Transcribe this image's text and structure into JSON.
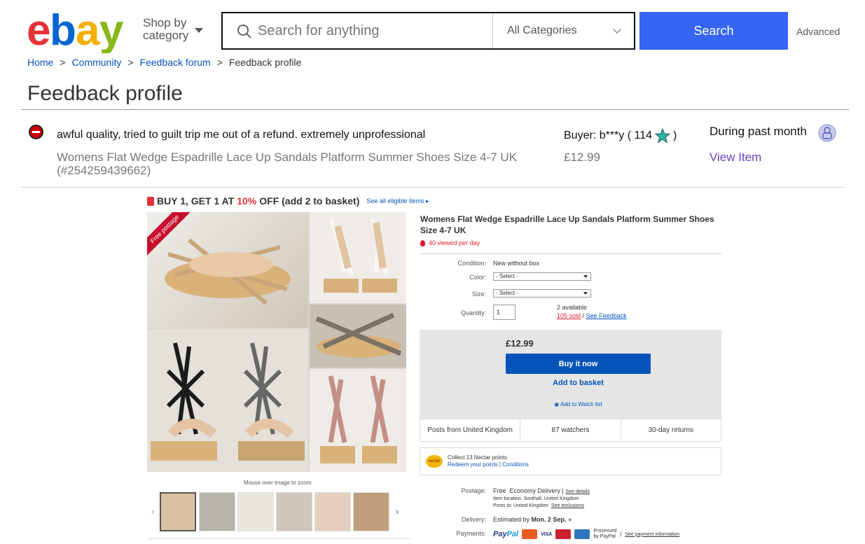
{
  "header": {
    "logo_text": [
      "e",
      "b",
      "a",
      "y"
    ],
    "logo_colors": [
      "#e53238",
      "#0064d2",
      "#f5af02",
      "#86b817"
    ],
    "shop_by": "Shop by",
    "shop_by_2": "category",
    "search_placeholder": "Search for anything",
    "category_selected": "All Categories",
    "search_button": "Search",
    "advanced": "Advanced"
  },
  "breadcrumb": {
    "items": [
      "Home",
      "Community",
      "Feedback forum",
      "Feedback profile"
    ],
    "separator": ">"
  },
  "page_title": "Feedback profile",
  "feedback": {
    "rating": "negative",
    "comment": "awful quality, tried to guilt trip me out of a refund. extremely unprofessional",
    "item_title": "Womens Flat Wedge Espadrille Lace Up Sandals Platform Summer Shoes Size 4-7 UK (#254259439662)",
    "buyer_label": "Buyer: b***y ( 114",
    "buyer_close": ")",
    "price": "£12.99",
    "period": "During past month",
    "view_item": "View Item",
    "star_color": "#30b0a0"
  },
  "listing": {
    "promo": {
      "part1": "BUY 1, GET 1 AT",
      "pct": "10%",
      "part2": "OFF (add 2 to basket)",
      "link": "See all eligible items ▸"
    },
    "banner": "Free postage",
    "zoom_hint": "Mouse over image to zoom",
    "title": "Womens Flat Wedge Espadrille Lace Up Sandals Platform Summer Shoes Size 4-7 UK",
    "viewed": "40 viewed per day",
    "condition_label": "Condition:",
    "condition_value": "New without box",
    "color_label": "Color:",
    "color_select": "- Select -",
    "size_label": "Size:",
    "size_select": "- Select -",
    "quantity_label": "Quantity:",
    "quantity_value": "1",
    "available": "2 available",
    "sold": "105 sold",
    "sold_sep": " / ",
    "see_feedback": "See Feedback",
    "price": "£12.99",
    "buy_now": "Buy it now",
    "add_basket": "Add to basket",
    "watch": "Add to Watch list",
    "facts": [
      "Posts from United Kingdom",
      "87 watchers",
      "30-day returns"
    ],
    "nectar_logo": "nectar",
    "nectar_line1": "Collect 13 Nectar points",
    "nectar_link1": "Redeem your points",
    "nectar_sep": " | ",
    "nectar_link2": "Conditions",
    "postage_label": "Postage:",
    "postage_free": "Free",
    "postage_value": "Economy Delivery |",
    "see_details": "See details",
    "item_location": "Item location:  Southall, United Kingdom",
    "posts_to": "Posts to:  United Kingdom",
    "see_exclusions": "See exclusions",
    "delivery_label": "Delivery:",
    "delivery_value": "Estimated by",
    "delivery_date": "Mon. 2 Sep.",
    "payments_label": "Payments:",
    "paypal_1": "Pay",
    "paypal_2": "Pal",
    "visa": "VISA",
    "processed_1": "Processed",
    "processed_2": "by PayPal",
    "pay_sep": "|",
    "see_payment": "See payment information"
  }
}
